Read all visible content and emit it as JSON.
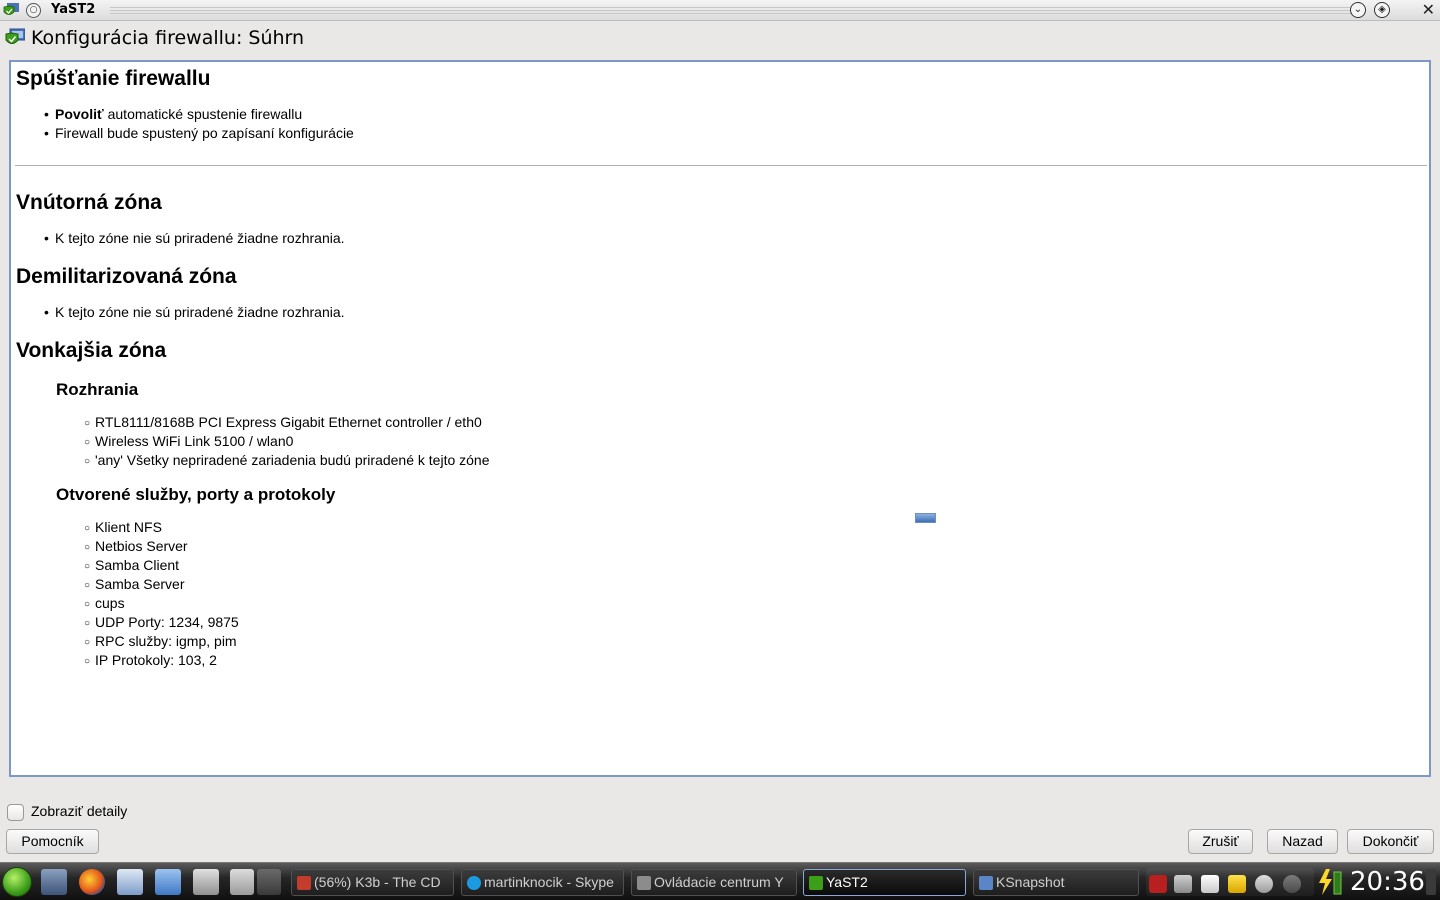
{
  "window": {
    "title": "YaST2"
  },
  "dialog": {
    "title": "Konfigurácia firewallu: Súhrn"
  },
  "sections": {
    "startup": {
      "heading": "Spúšťanie firewallu",
      "items": [
        {
          "bold": "Povoliť",
          "text": " automatické spustenie firewallu"
        },
        {
          "bold": "",
          "text": "Firewall bude spustený po zapísaní konfigurácie"
        }
      ]
    },
    "internal": {
      "heading": "Vnútorná zóna",
      "items": [
        "K tejto zóne nie sú priradené žiadne rozhrania."
      ]
    },
    "dmz": {
      "heading": "Demilitarizovaná zóna",
      "items": [
        "K tejto zóne nie sú priradené žiadne rozhrania."
      ]
    },
    "external": {
      "heading": "Vonkajšia zóna",
      "interfaces_heading": "Rozhrania",
      "interfaces": [
        "RTL8111/8168B PCI Express Gigabit Ethernet controller / eth0",
        "Wireless WiFi Link 5100 / wlan0",
        "'any' Všetky nepriradené zariadenia budú priradené k tejto zóne"
      ],
      "services_heading": "Otvorené služby, porty a protokoly",
      "services": [
        "Klient NFS",
        "Netbios Server",
        "Samba Client",
        "Samba Server",
        "cups",
        "UDP Porty: 1234, 9875",
        "RPC služby: igmp, pim",
        "IP Protokoly: 103, 2"
      ]
    }
  },
  "controls": {
    "show_details": "Zobraziť detaily",
    "help": "Pomocník",
    "cancel": "Zrušiť",
    "back": "Nazad",
    "finish": "Dokončiť"
  },
  "taskbar": {
    "tasks": [
      "(56%) K3b - The CD",
      "martinknocik - Skype",
      "Ovládacie centrum Y",
      "YaST2",
      "KSnapshot"
    ],
    "clock": "20:36"
  },
  "colors": {
    "frame_border": "#7c98c6",
    "taskbar": "#1e1e1e",
    "accent": "#3c9e19"
  }
}
